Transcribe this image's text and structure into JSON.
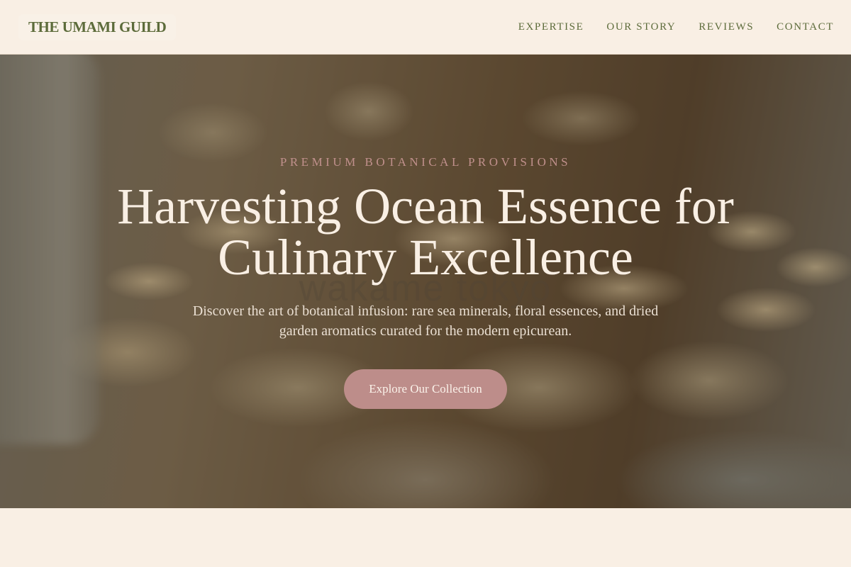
{
  "header": {
    "logo": "THE UMAMI GUILD",
    "nav": [
      {
        "label": "EXPERTISE"
      },
      {
        "label": "OUR STORY"
      },
      {
        "label": "REVIEWS"
      },
      {
        "label": "CONTACT"
      }
    ]
  },
  "hero": {
    "eyebrow": "PREMIUM BOTANICAL PROVISIONS",
    "headline": "Harvesting Ocean Essence for Culinary Excellence",
    "subtext": "Discover the art of botanical infusion: rare sea minerals, floral essences, and dried garden aromatics curated for the modern epicurean.",
    "cta_label": "Explore Our Collection",
    "watermark": "wakame tokyo"
  },
  "colors": {
    "background": "#f9efe4",
    "brand_green": "#5c6b3a",
    "accent_rose": "#bd8d8a",
    "headline_cream": "#f9efe4"
  }
}
